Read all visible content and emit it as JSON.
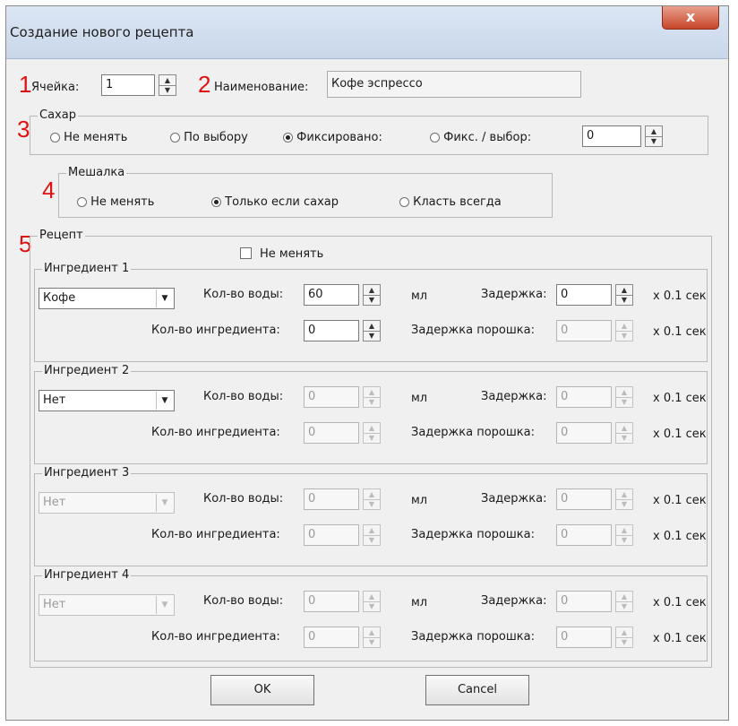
{
  "window": {
    "title": "Создание нового рецепта",
    "close_glyph": "x"
  },
  "markers": [
    "1",
    "2",
    "3",
    "4",
    "5"
  ],
  "cell": {
    "label": "Ячейка:",
    "value": "1"
  },
  "name": {
    "label": "Наименование:",
    "value": "Кофе эспрессо"
  },
  "sugar": {
    "title": "Сахар",
    "options": [
      "Не менять",
      "По выбору",
      "Фиксировано:",
      "Фикс. / выбор:"
    ],
    "selected": 2,
    "value": "0"
  },
  "stirrer": {
    "title": "Мешалка",
    "options": [
      "Не менять",
      "Только если сахар",
      "Класть всегда"
    ],
    "selected": 1
  },
  "recipe": {
    "title": "Рецепт",
    "no_change_label": "Не менять",
    "labels": {
      "water": "Кол-во воды:",
      "ml": "мл",
      "delay": "Задержка:",
      "sec": "x 0.1 сек",
      "ingredient_amount": "Кол-во ингредиента:",
      "powder_delay": "Задержка порошка:"
    },
    "ingredients": [
      {
        "title": "Ингредиент 1",
        "combo": "Кофе",
        "water": "60",
        "delay": "0",
        "amount": "0",
        "powder_delay": "0"
      },
      {
        "title": "Ингредиент 2",
        "combo": "Нет",
        "water": "0",
        "delay": "0",
        "amount": "0",
        "powder_delay": "0"
      },
      {
        "title": "Ингредиент 3",
        "combo": "Нет",
        "water": "0",
        "delay": "0",
        "amount": "0",
        "powder_delay": "0"
      },
      {
        "title": "Ингредиент 4",
        "combo": "Нет",
        "water": "0",
        "delay": "0",
        "amount": "0",
        "powder_delay": "0"
      }
    ]
  },
  "buttons": {
    "ok": "OK",
    "cancel": "Cancel"
  }
}
